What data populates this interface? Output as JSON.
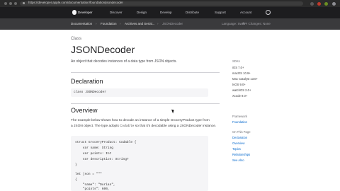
{
  "browser": {
    "url": "https://developer.apple.com/documentation/foundation/jsondecoder"
  },
  "topnav": {
    "brand": "Developer",
    "items": [
      "Discover",
      "Design",
      "Develop",
      "Distribute",
      "Support",
      "Account"
    ]
  },
  "breadcrumb": {
    "items": [
      "Documentation",
      "Foundation",
      "Archives and Serial...",
      "JSONDecoder"
    ],
    "language_label": "Language: Swift",
    "api_changes_label": "API Changes: None"
  },
  "main": {
    "kind": "Class",
    "title": "JSONDecoder",
    "abstract": "An object that decodes instances of a data type from JSON objects.",
    "declaration_heading": "Declaration",
    "declaration_code": "class JSONDecoder",
    "overview_heading": "Overview",
    "overview_line1": "The example below shows how to decode an instance of a simple GroceryProduct type from",
    "overview_line2_pre": "a JSON object. The type adopts ",
    "overview_line2_code": "Codable",
    "overview_line2_post": " so that it's decodable using a JSONDecoder instance.",
    "code_lines": [
      "struct GroceryProduct: Codable {",
      "    var name: String",
      "    var points: Int",
      "    var description: String?",
      "}",
      "",
      "let json = \"\"\"",
      "{",
      "    \"name\": \"Durian\",",
      "    \"points\": 600,"
    ]
  },
  "sidebar": {
    "sdk_label": "SDKs",
    "sdks": [
      "iOS 7.0+",
      "macOS 10.9+",
      "Mac Catalyst 13.0+",
      "tvOS 9.0+",
      "watchOS 2.0+",
      "Xcode 9.0+"
    ],
    "framework_label": "Framework",
    "framework": "Foundation",
    "on_this_page_label": "On This Page",
    "on_this_page": [
      "Declaration",
      "Overview",
      "Topics",
      "Relationships",
      "See Also"
    ]
  }
}
